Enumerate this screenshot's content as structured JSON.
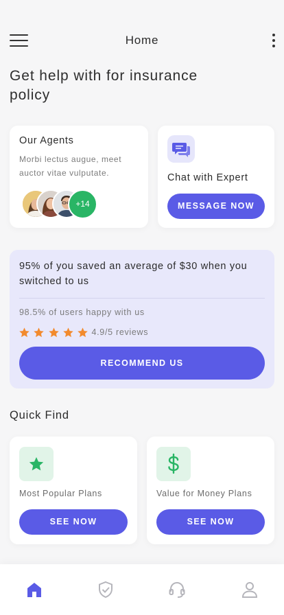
{
  "header": {
    "title": "Home",
    "menu_icon": "hamburger-menu-icon",
    "more_icon": "more-vertical-icon"
  },
  "headline": "Get help with for insurance policy",
  "agents_card": {
    "title": "Our Agents",
    "description": "Morbi lectus augue, meet auctor vitae vulputate.",
    "more_count": "+14",
    "avatar_colors": [
      "#e9c77a",
      "#d9d2cc",
      "#e0e3e6"
    ]
  },
  "chat_card": {
    "icon": "chat-bubbles-icon",
    "label": "Chat with Expert",
    "button": "MESSAGE NOW"
  },
  "savings": {
    "headline": "95% of you saved an average of $30 when you switched to us",
    "happy_users": "98.5% of users happy with us",
    "rating": 5,
    "reviews": "4.9/5 reviews",
    "button": "RECOMMEND US"
  },
  "quick_find": {
    "title": "Quick Find",
    "items": [
      {
        "icon": "star-icon",
        "label": "Most Popular Plans",
        "button": "SEE NOW"
      },
      {
        "icon": "dollar-icon",
        "label": "Value for Money Plans",
        "button": "SEE NOW"
      }
    ]
  },
  "bottom_nav": {
    "items": [
      {
        "icon": "home-icon",
        "active": true
      },
      {
        "icon": "shield-check-icon",
        "active": false
      },
      {
        "icon": "headset-icon",
        "active": false
      },
      {
        "icon": "profile-icon",
        "active": false
      }
    ]
  },
  "colors": {
    "primary": "#5a5be6",
    "green": "#29b565",
    "star": "#f28a2e",
    "panel": "#e8e8fb",
    "inactive_icon": "#b5b5bb"
  }
}
